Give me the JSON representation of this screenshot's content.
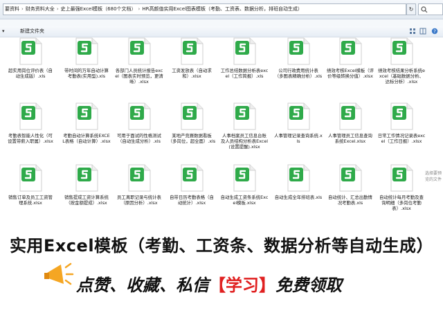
{
  "address_bar": {
    "crumbs": [
      "要资料",
      "财务资料大全",
      "史上最强Excel模板（680个文档）",
      "HR高颜值实用Excel图表模板（考勤、工资表、数据分析，排班自动生成）"
    ],
    "refresh_label": "↻",
    "search_placeholder": "搜索 HR...",
    "breadcrumb_separator": "›"
  },
  "toolbar": {
    "dropdown_label": "▾",
    "new_folder_label": "新建文件夹"
  },
  "files": [
    {
      "name": "超实用岗位评价表（自动生成版）.xls"
    },
    {
      "name": "带时间的万年自动计算考勤表(实用型).xls"
    },
    {
      "name": "各部门人员统计报告excel（图表实时预览，更清晰）.xlsx"
    },
    {
      "name": "工资发放表（自动求和）.xlsx"
    },
    {
      "name": "工作总结数据分析表excel（工作简报）.xls"
    },
    {
      "name": "公司行政费用统计表（多图表精确分析）.xls"
    },
    {
      "name": "绩效考核Excel模板（评价等级转换分值）.xlsx"
    },
    {
      "name": "绩效考核结果分析系统excel（基础数据分析、达标分析）.xlsx"
    },
    {
      "name": "考勤表智能人性化（可设置带薪入职属）.xlsx"
    },
    {
      "name": "考勤自动计算系统EXCEL表格（自动计算）.xlsx"
    },
    {
      "name": "可用于面试的性格测试（自动生成分析）.xls"
    },
    {
      "name": "某地产竞赛数据看板（多岗位，超全面）.xls"
    },
    {
      "name": "人事档案员工信息台账及人员结构分析表Excel(设置提醒).xlsx"
    },
    {
      "name": "人事管理记录查询系统.xls"
    },
    {
      "name": "人事管理员工信息查询系统Excel.xlsx"
    },
    {
      "name": "日常工作情况记录表excel（工作日报）.xlsx"
    },
    {
      "name": "销售订单及员工工资管理系统.xlsx"
    },
    {
      "name": "销售提成工资计算系统（按金额提成）.xlsx"
    },
    {
      "name": "员工离职记录与统计表（原因分析）.xlsx"
    },
    {
      "name": "自带日历考勤表格（自动统计）.xlsx"
    },
    {
      "name": "自动生成工资条系统Excel模板.xlsx"
    },
    {
      "name": "自动生成全年排班表.xls"
    },
    {
      "name": "自动统计、汇总出勤情况考勤表.xls"
    },
    {
      "name": "自动统计每月考勤及查询明细（多岗位考勤表）.xlsx"
    }
  ],
  "side_hint": "选择要预览的文件",
  "banner": {
    "title": "实用Excel模板（考勤、工资条、数据分析等自动生成）",
    "cta_prefix": "点赞、收藏、私信",
    "cta_strong": "【学习】",
    "cta_suffix": "免费领取"
  },
  "colors": {
    "excel_green": "#2faa4a",
    "accent_red": "#e02020",
    "megaphone_orange": "#f5a623"
  }
}
